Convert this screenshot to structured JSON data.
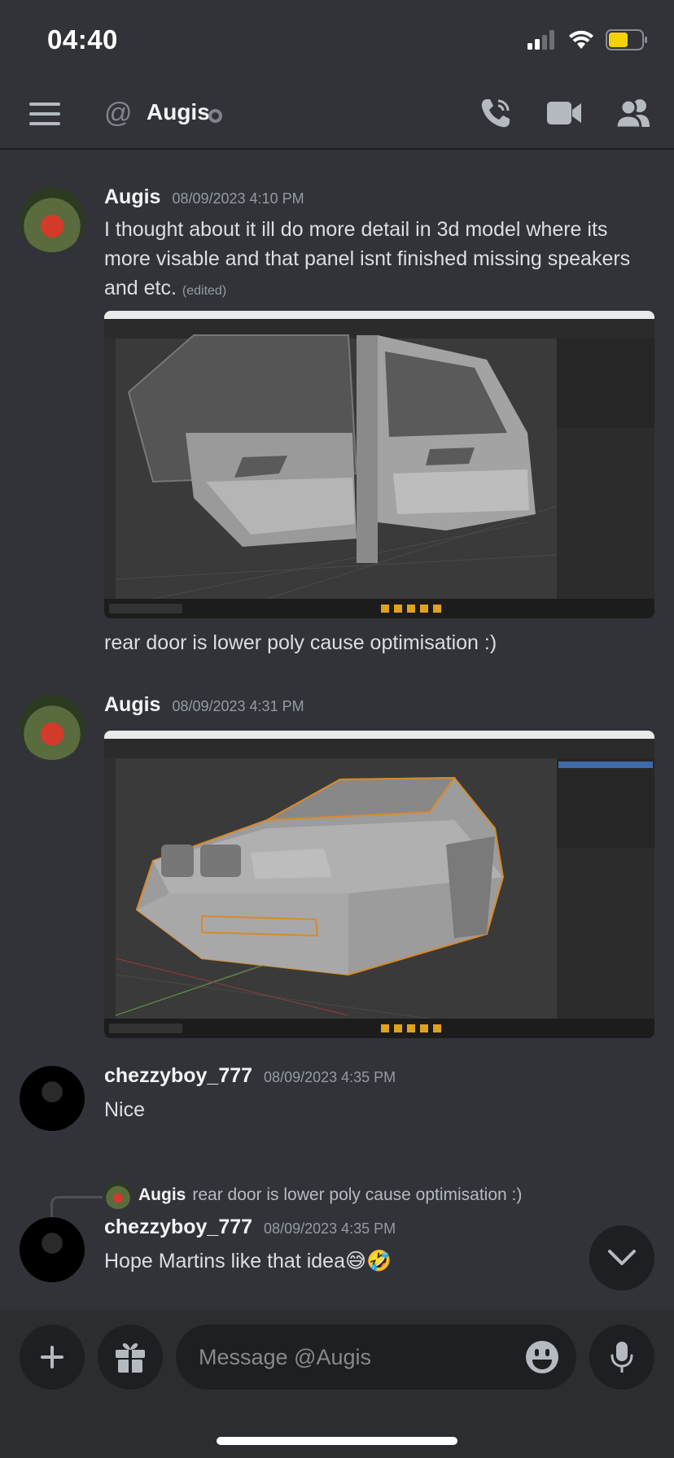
{
  "status_bar": {
    "time": "04:40"
  },
  "header": {
    "title": "Augis"
  },
  "messages": [
    {
      "author": "Augis",
      "timestamp": "08/09/2023 4:10 PM",
      "text": "I thought about it ill do more detail in 3d model where its more visable and that panel isnt finished missing speakers and etc.",
      "edited_label": "(edited)",
      "followup_text": "rear door is lower poly cause optimisation :)"
    },
    {
      "author": "Augis",
      "timestamp": "08/09/2023 4:31 PM"
    },
    {
      "author": "chezzyboy_777",
      "timestamp": "08/09/2023 4:35 PM",
      "text": "Nice"
    },
    {
      "author": "chezzyboy_777",
      "timestamp": "08/09/2023 4:35 PM",
      "text": "Hope Martins like that idea😅🤣",
      "reply": {
        "author": "Augis",
        "text": "rear door is lower poly cause optimisation :)"
      }
    }
  ],
  "composer": {
    "placeholder": "Message @Augis"
  },
  "icons": [
    "hamburger-icon",
    "at-icon",
    "call-icon",
    "video-icon",
    "members-icon",
    "plus-icon",
    "gift-icon",
    "emoji-icon",
    "mic-icon",
    "chevron-down-icon"
  ]
}
